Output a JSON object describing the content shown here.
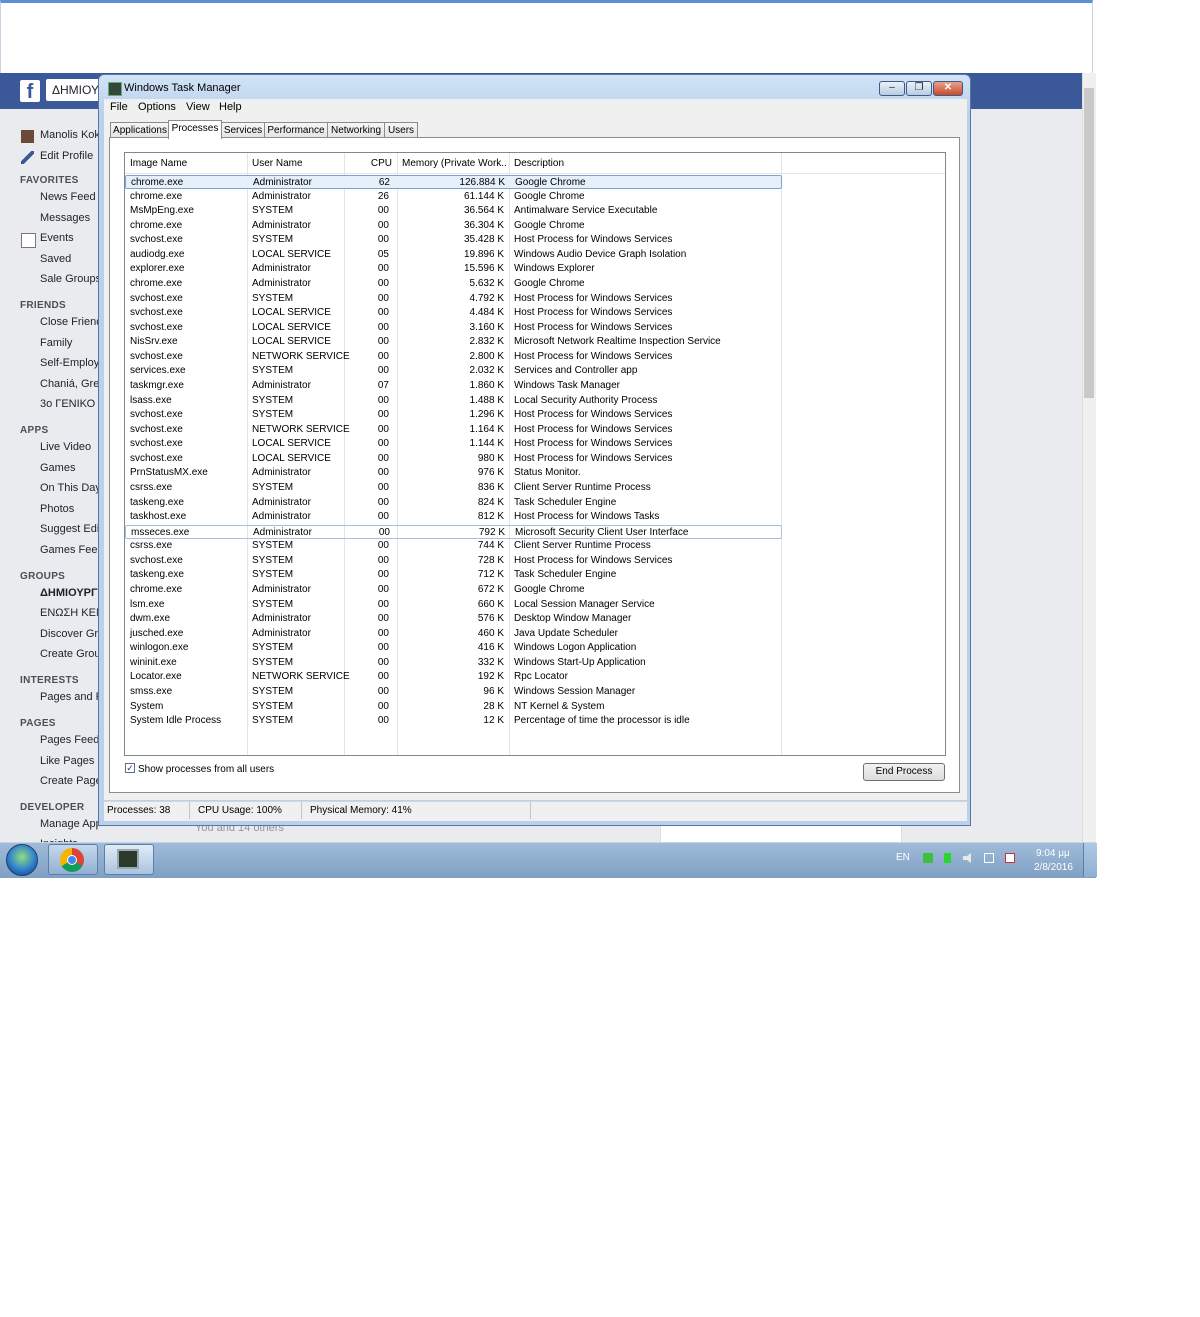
{
  "browser": {},
  "facebook": {
    "logo": "f",
    "page_title": "ΔΗΜΙΟΥΡΓΙ",
    "sidebar": [
      {
        "type": "item",
        "label": "Manolis Kok",
        "icon": "avatar"
      },
      {
        "type": "item",
        "label": "Edit Profile",
        "icon": "pencil-icon"
      },
      {
        "type": "header",
        "label": "FAVORITES"
      },
      {
        "type": "item",
        "label": "News Feed"
      },
      {
        "type": "item",
        "label": "Messages"
      },
      {
        "type": "item",
        "label": "Events",
        "icon": "calendar-icon"
      },
      {
        "type": "item",
        "label": "Saved"
      },
      {
        "type": "item",
        "label": "Sale Groups"
      },
      {
        "type": "header",
        "label": "FRIENDS"
      },
      {
        "type": "item",
        "label": "Close Friend"
      },
      {
        "type": "item",
        "label": "Family"
      },
      {
        "type": "item",
        "label": "Self-Employ"
      },
      {
        "type": "item",
        "label": "Chaniá, Gre"
      },
      {
        "type": "item",
        "label": "3ο ΓΕΝΙΚΟ /"
      },
      {
        "type": "header",
        "label": "APPS"
      },
      {
        "type": "item",
        "label": "Live Video"
      },
      {
        "type": "item",
        "label": "Games"
      },
      {
        "type": "item",
        "label": "On This Day"
      },
      {
        "type": "item",
        "label": "Photos"
      },
      {
        "type": "item",
        "label": "Suggest Edi"
      },
      {
        "type": "item",
        "label": "Games Feed"
      },
      {
        "type": "header",
        "label": "GROUPS"
      },
      {
        "type": "item",
        "label": "ΔΗΜΙΟΥΡΓΙ",
        "bold": true
      },
      {
        "type": "item",
        "label": "ΕΝΩΣΗ ΚΕΝ"
      },
      {
        "type": "item",
        "label": "Discover Gro"
      },
      {
        "type": "item",
        "label": "Create Grou"
      },
      {
        "type": "header",
        "label": "INTERESTS"
      },
      {
        "type": "item",
        "label": "Pages and F"
      },
      {
        "type": "header",
        "label": "PAGES"
      },
      {
        "type": "item",
        "label": "Pages Feed"
      },
      {
        "type": "item",
        "label": "Like Pages"
      },
      {
        "type": "item",
        "label": "Create Page"
      },
      {
        "type": "header",
        "label": "DEVELOPER"
      },
      {
        "type": "item",
        "label": "Manage App"
      },
      {
        "type": "item",
        "label": "Insights"
      }
    ],
    "peek_text": "You and 14 others"
  },
  "task_manager": {
    "title": "Windows Task Manager",
    "caption_buttons": {
      "minimize": "–",
      "restore": "❐",
      "close": "✕"
    },
    "menu": [
      "File",
      "Options",
      "View",
      "Help"
    ],
    "tabs": [
      {
        "label": "Applications",
        "active": false
      },
      {
        "label": "Processes",
        "active": true
      },
      {
        "label": "Services",
        "active": false
      },
      {
        "label": "Performance",
        "active": false
      },
      {
        "label": "Networking",
        "active": false
      },
      {
        "label": "Users",
        "active": false
      }
    ],
    "columns": {
      "image": "Image Name",
      "user": "User Name",
      "cpu": "CPU",
      "memory": "Memory (Private Work...",
      "description": "Description"
    },
    "processes": [
      {
        "name": "chrome.exe",
        "user": "Administrator",
        "cpu": "62",
        "mem": "126.884 K",
        "desc": "Google Chrome",
        "state": "selected"
      },
      {
        "name": "chrome.exe",
        "user": "Administrator",
        "cpu": "26",
        "mem": "61.144 K",
        "desc": "Google Chrome"
      },
      {
        "name": "MsMpEng.exe",
        "user": "SYSTEM",
        "cpu": "00",
        "mem": "36.564 K",
        "desc": "Antimalware Service Executable"
      },
      {
        "name": "chrome.exe",
        "user": "Administrator",
        "cpu": "00",
        "mem": "36.304 K",
        "desc": "Google Chrome"
      },
      {
        "name": "svchost.exe",
        "user": "SYSTEM",
        "cpu": "00",
        "mem": "35.428 K",
        "desc": "Host Process for Windows Services"
      },
      {
        "name": "audiodg.exe",
        "user": "LOCAL SERVICE",
        "cpu": "05",
        "mem": "19.896 K",
        "desc": "Windows Audio Device Graph Isolation"
      },
      {
        "name": "explorer.exe",
        "user": "Administrator",
        "cpu": "00",
        "mem": "15.596 K",
        "desc": "Windows Explorer"
      },
      {
        "name": "chrome.exe",
        "user": "Administrator",
        "cpu": "00",
        "mem": "5.632 K",
        "desc": "Google Chrome"
      },
      {
        "name": "svchost.exe",
        "user": "SYSTEM",
        "cpu": "00",
        "mem": "4.792 K",
        "desc": "Host Process for Windows Services"
      },
      {
        "name": "svchost.exe",
        "user": "LOCAL SERVICE",
        "cpu": "00",
        "mem": "4.484 K",
        "desc": "Host Process for Windows Services"
      },
      {
        "name": "svchost.exe",
        "user": "LOCAL SERVICE",
        "cpu": "00",
        "mem": "3.160 K",
        "desc": "Host Process for Windows Services"
      },
      {
        "name": "NisSrv.exe",
        "user": "LOCAL SERVICE",
        "cpu": "00",
        "mem": "2.832 K",
        "desc": "Microsoft Network Realtime Inspection Service"
      },
      {
        "name": "svchost.exe",
        "user": "NETWORK SERVICE",
        "cpu": "00",
        "mem": "2.800 K",
        "desc": "Host Process for Windows Services"
      },
      {
        "name": "services.exe",
        "user": "SYSTEM",
        "cpu": "00",
        "mem": "2.032 K",
        "desc": "Services and Controller app"
      },
      {
        "name": "taskmgr.exe",
        "user": "Administrator",
        "cpu": "07",
        "mem": "1.860 K",
        "desc": "Windows Task Manager"
      },
      {
        "name": "lsass.exe",
        "user": "SYSTEM",
        "cpu": "00",
        "mem": "1.488 K",
        "desc": "Local Security Authority Process"
      },
      {
        "name": "svchost.exe",
        "user": "SYSTEM",
        "cpu": "00",
        "mem": "1.296 K",
        "desc": "Host Process for Windows Services"
      },
      {
        "name": "svchost.exe",
        "user": "NETWORK SERVICE",
        "cpu": "00",
        "mem": "1.164 K",
        "desc": "Host Process for Windows Services"
      },
      {
        "name": "svchost.exe",
        "user": "LOCAL SERVICE",
        "cpu": "00",
        "mem": "1.144 K",
        "desc": "Host Process for Windows Services"
      },
      {
        "name": "svchost.exe",
        "user": "LOCAL SERVICE",
        "cpu": "00",
        "mem": "980 K",
        "desc": "Host Process for Windows Services"
      },
      {
        "name": "PrnStatusMX.exe",
        "user": "Administrator",
        "cpu": "00",
        "mem": "976 K",
        "desc": "Status Monitor."
      },
      {
        "name": "csrss.exe",
        "user": "SYSTEM",
        "cpu": "00",
        "mem": "836 K",
        "desc": "Client Server Runtime Process"
      },
      {
        "name": "taskeng.exe",
        "user": "Administrator",
        "cpu": "00",
        "mem": "824 K",
        "desc": "Task Scheduler Engine"
      },
      {
        "name": "taskhost.exe",
        "user": "Administrator",
        "cpu": "00",
        "mem": "812 K",
        "desc": "Host Process for Windows Tasks"
      },
      {
        "name": "msseces.exe",
        "user": "Administrator",
        "cpu": "00",
        "mem": "792 K",
        "desc": "Microsoft Security Client User Interface",
        "state": "focused"
      },
      {
        "name": "csrss.exe",
        "user": "SYSTEM",
        "cpu": "00",
        "mem": "744 K",
        "desc": "Client Server Runtime Process"
      },
      {
        "name": "svchost.exe",
        "user": "SYSTEM",
        "cpu": "00",
        "mem": "728 K",
        "desc": "Host Process for Windows Services"
      },
      {
        "name": "taskeng.exe",
        "user": "SYSTEM",
        "cpu": "00",
        "mem": "712 K",
        "desc": "Task Scheduler Engine"
      },
      {
        "name": "chrome.exe",
        "user": "Administrator",
        "cpu": "00",
        "mem": "672 K",
        "desc": "Google Chrome"
      },
      {
        "name": "lsm.exe",
        "user": "SYSTEM",
        "cpu": "00",
        "mem": "660 K",
        "desc": "Local Session Manager Service"
      },
      {
        "name": "dwm.exe",
        "user": "Administrator",
        "cpu": "00",
        "mem": "576 K",
        "desc": "Desktop Window Manager"
      },
      {
        "name": "jusched.exe",
        "user": "Administrator",
        "cpu": "00",
        "mem": "460 K",
        "desc": "Java Update Scheduler"
      },
      {
        "name": "winlogon.exe",
        "user": "SYSTEM",
        "cpu": "00",
        "mem": "416 K",
        "desc": "Windows Logon Application"
      },
      {
        "name": "wininit.exe",
        "user": "SYSTEM",
        "cpu": "00",
        "mem": "332 K",
        "desc": "Windows Start-Up Application"
      },
      {
        "name": "Locator.exe",
        "user": "NETWORK SERVICE",
        "cpu": "00",
        "mem": "192 K",
        "desc": "Rpc Locator"
      },
      {
        "name": "smss.exe",
        "user": "SYSTEM",
        "cpu": "00",
        "mem": "96 K",
        "desc": "Windows Session Manager"
      },
      {
        "name": "System",
        "user": "SYSTEM",
        "cpu": "00",
        "mem": "28 K",
        "desc": "NT Kernel & System"
      },
      {
        "name": "System Idle Process",
        "user": "SYSTEM",
        "cpu": "00",
        "mem": "12 K",
        "desc": "Percentage of time the processor is idle"
      }
    ],
    "show_all_label": "Show processes from all users",
    "show_all_checked": true,
    "end_process_label": "End Process",
    "status": {
      "processes": "Processes: 38",
      "cpu": "CPU Usage: 100%",
      "memory": "Physical Memory: 41%"
    }
  },
  "taskbar": {
    "apps": [
      {
        "name": "chrome-icon"
      },
      {
        "name": "task-manager-icon",
        "active": true
      }
    ],
    "language": "EN",
    "time": "9:04 μμ",
    "date": "2/8/2016"
  }
}
